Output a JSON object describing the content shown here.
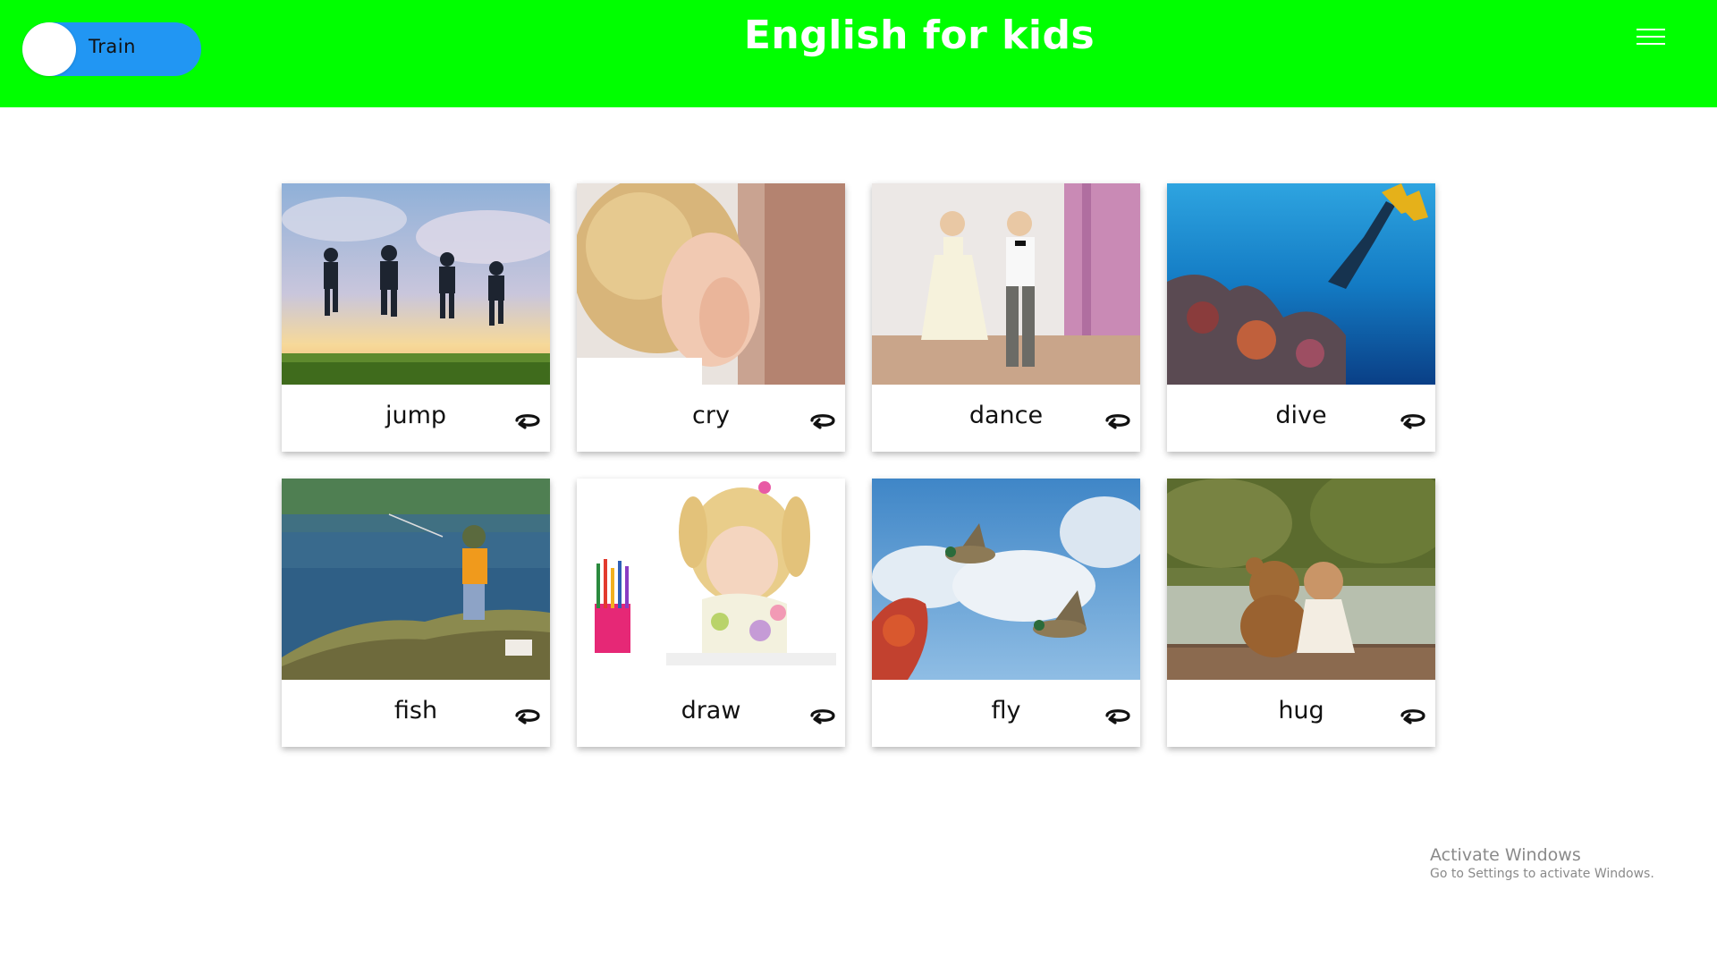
{
  "header": {
    "title": "English for kids",
    "mode_toggle_label": "Train",
    "background_color": "#00ff00",
    "toggle_color": "#2196f3",
    "menu_icon": "hamburger-icon"
  },
  "cards": [
    {
      "word": "jump",
      "image": "kids-jumping-photo",
      "action_icon": "rotate-icon"
    },
    {
      "word": "cry",
      "image": "child-crying-photo",
      "action_icon": "rotate-icon"
    },
    {
      "word": "dance",
      "image": "kids-dancing-photo",
      "action_icon": "rotate-icon"
    },
    {
      "word": "dive",
      "image": "diver-underwater-photo",
      "action_icon": "rotate-icon"
    },
    {
      "word": "fish",
      "image": "child-fishing-photo",
      "action_icon": "rotate-icon"
    },
    {
      "word": "draw",
      "image": "girl-drawing-photo",
      "action_icon": "rotate-icon"
    },
    {
      "word": "fly",
      "image": "ducks-flying-photo",
      "action_icon": "rotate-icon"
    },
    {
      "word": "hug",
      "image": "girl-hugging-teddy-photo",
      "action_icon": "rotate-icon"
    }
  ],
  "watermark": {
    "title": "Activate Windows",
    "subtitle": "Go to Settings to activate Windows."
  }
}
